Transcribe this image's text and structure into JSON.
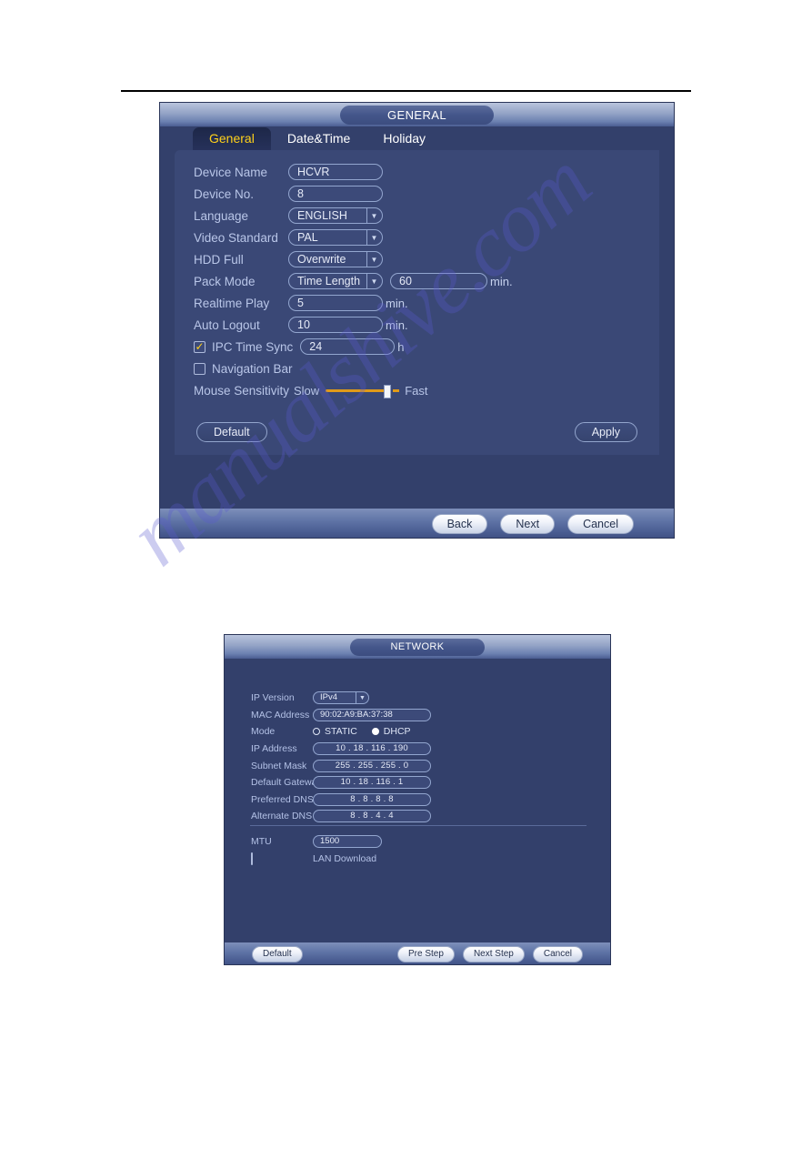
{
  "watermark": {
    "text": "manualshive.com"
  },
  "general_dialog": {
    "title": "GENERAL",
    "tabs": [
      {
        "label": "General",
        "active": true
      },
      {
        "label": "Date&Time",
        "active": false
      },
      {
        "label": "Holiday",
        "active": false
      }
    ],
    "fields": {
      "device_name": {
        "label": "Device Name",
        "value": "HCVR"
      },
      "device_no": {
        "label": "Device No.",
        "value": "8"
      },
      "language": {
        "label": "Language",
        "value": "ENGLISH"
      },
      "video_standard": {
        "label": "Video Standard",
        "value": "PAL"
      },
      "hdd_full": {
        "label": "HDD Full",
        "value": "Overwrite"
      },
      "pack_mode": {
        "label": "Pack Mode",
        "value": "Time Length",
        "length_value": "60",
        "length_unit": "min."
      },
      "realtime_play": {
        "label": "Realtime Play",
        "value": "5",
        "unit": "min."
      },
      "auto_logout": {
        "label": "Auto Logout",
        "value": "10",
        "unit": "min."
      },
      "ipc_time_sync": {
        "label": "IPC Time Sync",
        "checked": true,
        "check_glyph": "✓",
        "value": "24",
        "unit": "h"
      },
      "navigation_bar": {
        "label": "Navigation Bar",
        "checked": false
      },
      "mouse_sensitivity": {
        "label": "Mouse Sensitivity",
        "min_label": "Slow",
        "max_label": "Fast",
        "position_percent": 88
      }
    },
    "panel_buttons": {
      "default": "Default",
      "apply": "Apply"
    },
    "footer_buttons": {
      "back": "Back",
      "next": "Next",
      "cancel": "Cancel"
    }
  },
  "network_dialog": {
    "title": "NETWORK",
    "fields": {
      "ip_version": {
        "label": "IP Version",
        "value": "IPv4"
      },
      "mac_address": {
        "label": "MAC Address",
        "value": "90:02:A9:BA:37:38"
      },
      "mode": {
        "label": "Mode",
        "static_label": "STATIC",
        "dhcp_label": "DHCP",
        "selected": "DHCP"
      },
      "ip_address": {
        "label": "IP Address",
        "value": "10 .  18 .  116 .  190"
      },
      "subnet_mask": {
        "label": "Subnet Mask",
        "value": "255 . 255 . 255 .   0"
      },
      "default_gateway": {
        "label": "Default Gateway",
        "value": "10 .  18 .  116 .   1"
      },
      "preferred_dns": {
        "label": "Preferred DNS",
        "value": "8  .  8  .  8  .  8"
      },
      "alternate_dns": {
        "label": "Alternate DNS",
        "value": "8  .  8  .  4  .  4"
      },
      "mtu": {
        "label": "MTU",
        "value": "1500"
      },
      "lan_download": {
        "label": "LAN Download",
        "checked": false
      }
    },
    "footer_buttons": {
      "default": "Default",
      "pre_step": "Pre Step",
      "next_step": "Next Step",
      "cancel": "Cancel"
    }
  }
}
